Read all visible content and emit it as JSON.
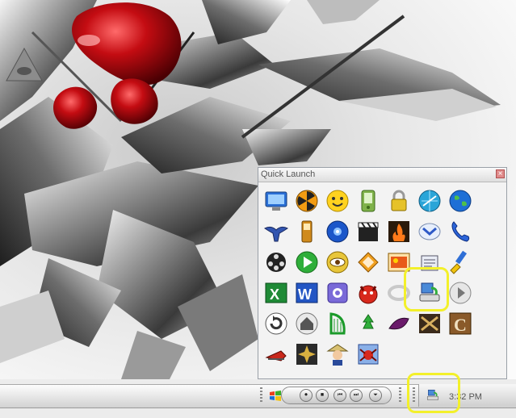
{
  "quick_launch": {
    "title": "Quick Launch",
    "close_glyph": "×",
    "icons": [
      [
        "monitor-icon",
        "radiation-icon",
        "smiley-icon",
        "pda-icon",
        "lock-icon",
        "globe-arrow-icon",
        "earth-icon"
      ],
      [
        "eagle-icon",
        "phone-icon",
        "disc-icon",
        "clapper-icon",
        "fire-icon",
        "mail-icon",
        "telephone-icon"
      ],
      [
        "film-reel-icon",
        "play-icon",
        "eye-icon",
        "folder-notes-icon",
        "window-image-icon",
        "document-icon",
        "brush-icon"
      ],
      [
        "excel-icon",
        "word-icon",
        "settings-icon",
        "devil-icon",
        "link-icon",
        "network-drive-icon",
        "next-icon"
      ],
      [
        "refresh-icon",
        "home-icon",
        "harp-icon",
        "recycle-icon",
        "leaf-icon",
        "tools-icon",
        "letter-c-icon"
      ],
      [
        "fish-icon",
        "star-icon",
        "farmer-icon",
        "spider-icon"
      ]
    ]
  },
  "taskbar": {
    "clock": "3:32 PM",
    "media_buttons": [
      "⏺",
      "■",
      "⏮",
      "⏭",
      "⏷"
    ]
  }
}
